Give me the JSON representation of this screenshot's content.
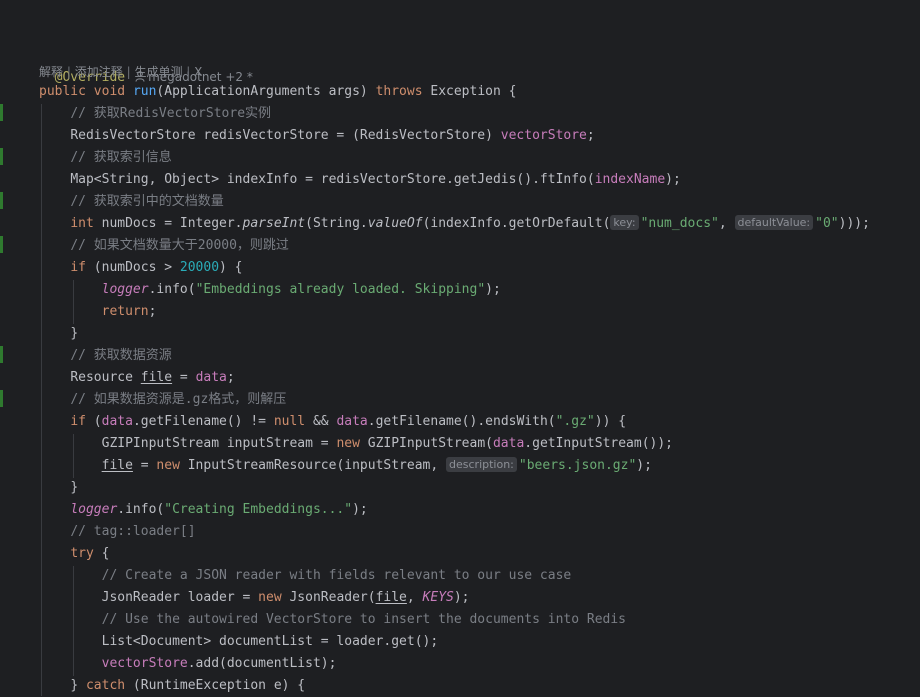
{
  "header": {
    "annotation": "@Override",
    "author": "megadotnet +2 *",
    "lens": [
      "解释",
      "添加注释",
      "生成单测",
      "X"
    ],
    "lens_separator": "|"
  },
  "gutter_icons": [
    "user-icon"
  ],
  "hints": {
    "key": "key:",
    "default_value": "defaultValue:",
    "description": "description:"
  },
  "code": {
    "l1": {
      "public": "public",
      "void": "void",
      "method": "run",
      "params": "(ApplicationArguments args) ",
      "throws": "throws",
      "rest": " Exception {"
    },
    "l2": "// 获取RedisVectorStore实例",
    "l3": {
      "a": "RedisVectorStore redisVectorStore = (RedisVectorStore) ",
      "field": "vectorStore",
      "b": ";"
    },
    "l4": "// 获取索引信息",
    "l5": {
      "a": "Map<String, Object> indexInfo = redisVectorStore.getJedis().ftInfo(",
      "field": "indexName",
      "b": ");"
    },
    "l6": "// 获取索引中的文档数量",
    "l7": {
      "int": "int",
      "a": " numDocs = Integer.",
      "m1": "parseInt",
      "b": "(String.",
      "m2": "valueOf",
      "c": "(indexInfo.getOrDefault(",
      "s1": "\"num_docs\"",
      "d": ", ",
      "s2": "\"0\"",
      "e": ")));"
    },
    "l8": "// 如果文档数量大于20000，则跳过",
    "l9": {
      "if": "if",
      "a": " (numDocs > ",
      "num": "20000",
      "b": ") {"
    },
    "l10": {
      "logger": "logger",
      "a": ".info(",
      "s": "\"Embeddings already loaded. Skipping\"",
      "b": ");"
    },
    "l11": {
      "ret": "return",
      "b": ";"
    },
    "l12": "}",
    "l13": "// 获取数据资源",
    "l14": {
      "a": "Resource ",
      "var": "file",
      "b": " = ",
      "field": "data",
      "c": ";"
    },
    "l15": "// 如果数据资源是.gz格式，则解压",
    "l16": {
      "if": "if",
      "a": " (",
      "f1": "data",
      "b": ".getFilename() != ",
      "null": "null",
      "c": " && ",
      "f2": "data",
      "d": ".getFilename().endsWith(",
      "s": "\".gz\"",
      "e": ")) {"
    },
    "l17": {
      "a": "GZIPInputStream inputStream = ",
      "new": "new",
      "b": " GZIPInputStream(",
      "f": "data",
      "c": ".getInputStream());"
    },
    "l18": {
      "var": "file",
      "a": " = ",
      "new": "new",
      "b": " InputStreamResource(inputStream, ",
      "s": "\"beers.json.gz\"",
      "c": ");"
    },
    "l19": "}",
    "l20": {
      "logger": "logger",
      "a": ".info(",
      "s": "\"Creating Embeddings...\"",
      "b": ");"
    },
    "l21": "// tag::loader[]",
    "l22": {
      "try": "try",
      "b": " {"
    },
    "l23": "// Create a JSON reader with fields relevant to our use case",
    "l24": {
      "a": "JsonReader loader = ",
      "new": "new",
      "b": " JsonReader(",
      "var": "file",
      "c": ", ",
      "keys": "KEYS",
      "d": ");"
    },
    "l25": "// Use the autowired VectorStore to insert the documents into Redis",
    "l26": {
      "a": "List<Document> documentList = loader.get();"
    },
    "l27": {
      "field": "vectorStore",
      "a": ".add(documentList);"
    },
    "l28": {
      "a": "} ",
      "catch": "catch",
      "b": " (RuntimeException e) {"
    }
  },
  "colors": {
    "background": "#1e1f22",
    "text": "#bcbec4",
    "keyword": "#cf8e6d",
    "comment": "#7a7e85",
    "string": "#6aab73",
    "number": "#2aacb8",
    "method": "#56a8f5",
    "field": "#c77dbb",
    "annotation": "#b3ae60",
    "gutter_change": "#2f7a2f"
  }
}
